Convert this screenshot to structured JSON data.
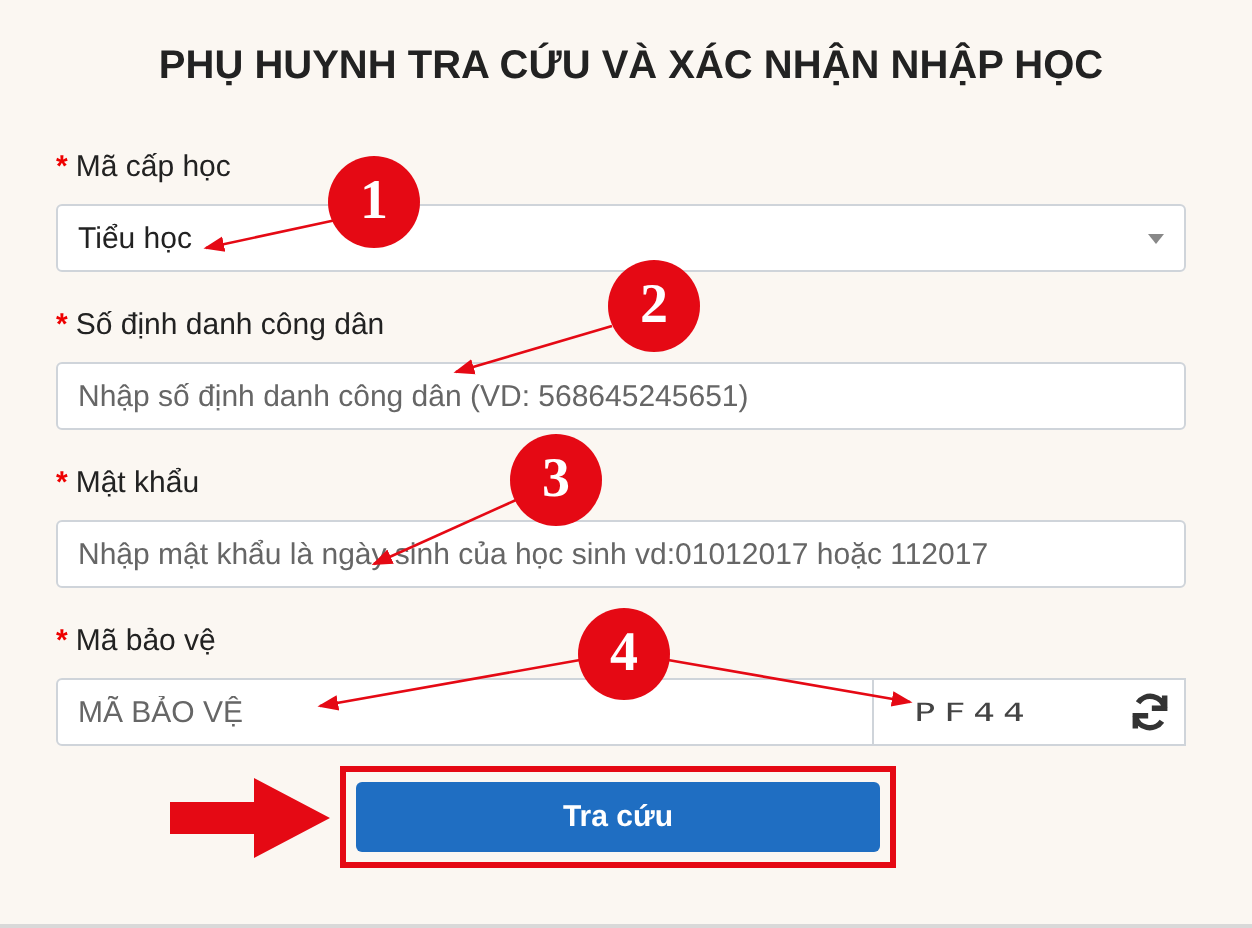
{
  "title": "PHỤ HUYNH TRA CỨU VÀ XÁC NHẬN NHẬP HỌC",
  "fields": [
    {
      "kind": "select",
      "marker": "*",
      "label": "Mã cấp học",
      "value": "Tiểu học"
    },
    {
      "kind": "text",
      "marker": "*",
      "label": "Số định danh công dân",
      "placeholder": "Nhập số định danh công dân (VD: 568645245651)"
    },
    {
      "kind": "text",
      "marker": "*",
      "label": "Mật khẩu",
      "placeholder": "Nhập mật khẩu là ngày sinh của học sinh vd:01012017 hoặc 112017"
    },
    {
      "kind": "captcha",
      "marker": "*",
      "label": "Mã bảo vệ",
      "placeholder": "MÃ BẢO VỆ",
      "captcha": "PF44"
    }
  ],
  "submit": {
    "label": "Tra cứu",
    "highlighted": true
  },
  "annotations": [
    {
      "number": "1"
    },
    {
      "number": "2"
    },
    {
      "number": "3"
    },
    {
      "number": "4"
    }
  ]
}
